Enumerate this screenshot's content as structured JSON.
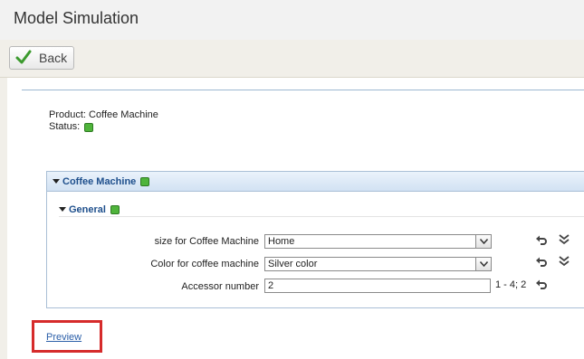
{
  "page": {
    "title": "Model Simulation"
  },
  "toolbar": {
    "back_label": "Back"
  },
  "info": {
    "product_label": "Product:",
    "product_value": "Coffee Machine",
    "status_label": "Status:"
  },
  "panel": {
    "title": "Coffee Machine"
  },
  "group": {
    "title": "General"
  },
  "fields": [
    {
      "label": "size for Coffee Machine",
      "value": "Home"
    },
    {
      "label": "Color for coffee machine",
      "value": "Silver color"
    },
    {
      "label": "Accessor number",
      "value": "2",
      "range": "1 - 4; 2"
    }
  ],
  "footer": {
    "preview_label": "Preview"
  },
  "colors": {
    "status_green": "#4fb43b",
    "link_blue": "#2a5ea8",
    "highlight_red": "#d62b2b",
    "panel_title_blue": "#1e4f8c"
  },
  "icons": {
    "back": "checkmark-icon",
    "reset": "undo-icon",
    "expand": "double-chevron-down-icon",
    "status": "green-status-square-icon"
  }
}
